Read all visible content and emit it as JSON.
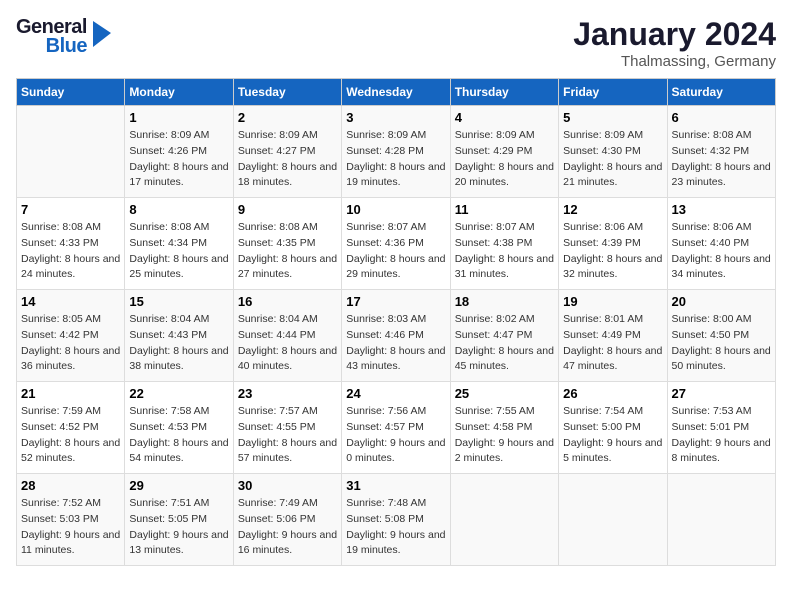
{
  "header": {
    "logo_line1": "General",
    "logo_line2": "Blue",
    "title": "January 2024",
    "subtitle": "Thalmassing, Germany"
  },
  "calendar": {
    "days_of_week": [
      "Sunday",
      "Monday",
      "Tuesday",
      "Wednesday",
      "Thursday",
      "Friday",
      "Saturday"
    ],
    "weeks": [
      [
        {
          "day": "",
          "sunrise": "",
          "sunset": "",
          "daylight": ""
        },
        {
          "day": "1",
          "sunrise": "Sunrise: 8:09 AM",
          "sunset": "Sunset: 4:26 PM",
          "daylight": "Daylight: 8 hours and 17 minutes."
        },
        {
          "day": "2",
          "sunrise": "Sunrise: 8:09 AM",
          "sunset": "Sunset: 4:27 PM",
          "daylight": "Daylight: 8 hours and 18 minutes."
        },
        {
          "day": "3",
          "sunrise": "Sunrise: 8:09 AM",
          "sunset": "Sunset: 4:28 PM",
          "daylight": "Daylight: 8 hours and 19 minutes."
        },
        {
          "day": "4",
          "sunrise": "Sunrise: 8:09 AM",
          "sunset": "Sunset: 4:29 PM",
          "daylight": "Daylight: 8 hours and 20 minutes."
        },
        {
          "day": "5",
          "sunrise": "Sunrise: 8:09 AM",
          "sunset": "Sunset: 4:30 PM",
          "daylight": "Daylight: 8 hours and 21 minutes."
        },
        {
          "day": "6",
          "sunrise": "Sunrise: 8:08 AM",
          "sunset": "Sunset: 4:32 PM",
          "daylight": "Daylight: 8 hours and 23 minutes."
        }
      ],
      [
        {
          "day": "7",
          "sunrise": "Sunrise: 8:08 AM",
          "sunset": "Sunset: 4:33 PM",
          "daylight": "Daylight: 8 hours and 24 minutes."
        },
        {
          "day": "8",
          "sunrise": "Sunrise: 8:08 AM",
          "sunset": "Sunset: 4:34 PM",
          "daylight": "Daylight: 8 hours and 25 minutes."
        },
        {
          "day": "9",
          "sunrise": "Sunrise: 8:08 AM",
          "sunset": "Sunset: 4:35 PM",
          "daylight": "Daylight: 8 hours and 27 minutes."
        },
        {
          "day": "10",
          "sunrise": "Sunrise: 8:07 AM",
          "sunset": "Sunset: 4:36 PM",
          "daylight": "Daylight: 8 hours and 29 minutes."
        },
        {
          "day": "11",
          "sunrise": "Sunrise: 8:07 AM",
          "sunset": "Sunset: 4:38 PM",
          "daylight": "Daylight: 8 hours and 31 minutes."
        },
        {
          "day": "12",
          "sunrise": "Sunrise: 8:06 AM",
          "sunset": "Sunset: 4:39 PM",
          "daylight": "Daylight: 8 hours and 32 minutes."
        },
        {
          "day": "13",
          "sunrise": "Sunrise: 8:06 AM",
          "sunset": "Sunset: 4:40 PM",
          "daylight": "Daylight: 8 hours and 34 minutes."
        }
      ],
      [
        {
          "day": "14",
          "sunrise": "Sunrise: 8:05 AM",
          "sunset": "Sunset: 4:42 PM",
          "daylight": "Daylight: 8 hours and 36 minutes."
        },
        {
          "day": "15",
          "sunrise": "Sunrise: 8:04 AM",
          "sunset": "Sunset: 4:43 PM",
          "daylight": "Daylight: 8 hours and 38 minutes."
        },
        {
          "day": "16",
          "sunrise": "Sunrise: 8:04 AM",
          "sunset": "Sunset: 4:44 PM",
          "daylight": "Daylight: 8 hours and 40 minutes."
        },
        {
          "day": "17",
          "sunrise": "Sunrise: 8:03 AM",
          "sunset": "Sunset: 4:46 PM",
          "daylight": "Daylight: 8 hours and 43 minutes."
        },
        {
          "day": "18",
          "sunrise": "Sunrise: 8:02 AM",
          "sunset": "Sunset: 4:47 PM",
          "daylight": "Daylight: 8 hours and 45 minutes."
        },
        {
          "day": "19",
          "sunrise": "Sunrise: 8:01 AM",
          "sunset": "Sunset: 4:49 PM",
          "daylight": "Daylight: 8 hours and 47 minutes."
        },
        {
          "day": "20",
          "sunrise": "Sunrise: 8:00 AM",
          "sunset": "Sunset: 4:50 PM",
          "daylight": "Daylight: 8 hours and 50 minutes."
        }
      ],
      [
        {
          "day": "21",
          "sunrise": "Sunrise: 7:59 AM",
          "sunset": "Sunset: 4:52 PM",
          "daylight": "Daylight: 8 hours and 52 minutes."
        },
        {
          "day": "22",
          "sunrise": "Sunrise: 7:58 AM",
          "sunset": "Sunset: 4:53 PM",
          "daylight": "Daylight: 8 hours and 54 minutes."
        },
        {
          "day": "23",
          "sunrise": "Sunrise: 7:57 AM",
          "sunset": "Sunset: 4:55 PM",
          "daylight": "Daylight: 8 hours and 57 minutes."
        },
        {
          "day": "24",
          "sunrise": "Sunrise: 7:56 AM",
          "sunset": "Sunset: 4:57 PM",
          "daylight": "Daylight: 9 hours and 0 minutes."
        },
        {
          "day": "25",
          "sunrise": "Sunrise: 7:55 AM",
          "sunset": "Sunset: 4:58 PM",
          "daylight": "Daylight: 9 hours and 2 minutes."
        },
        {
          "day": "26",
          "sunrise": "Sunrise: 7:54 AM",
          "sunset": "Sunset: 5:00 PM",
          "daylight": "Daylight: 9 hours and 5 minutes."
        },
        {
          "day": "27",
          "sunrise": "Sunrise: 7:53 AM",
          "sunset": "Sunset: 5:01 PM",
          "daylight": "Daylight: 9 hours and 8 minutes."
        }
      ],
      [
        {
          "day": "28",
          "sunrise": "Sunrise: 7:52 AM",
          "sunset": "Sunset: 5:03 PM",
          "daylight": "Daylight: 9 hours and 11 minutes."
        },
        {
          "day": "29",
          "sunrise": "Sunrise: 7:51 AM",
          "sunset": "Sunset: 5:05 PM",
          "daylight": "Daylight: 9 hours and 13 minutes."
        },
        {
          "day": "30",
          "sunrise": "Sunrise: 7:49 AM",
          "sunset": "Sunset: 5:06 PM",
          "daylight": "Daylight: 9 hours and 16 minutes."
        },
        {
          "day": "31",
          "sunrise": "Sunrise: 7:48 AM",
          "sunset": "Sunset: 5:08 PM",
          "daylight": "Daylight: 9 hours and 19 minutes."
        },
        {
          "day": "",
          "sunrise": "",
          "sunset": "",
          "daylight": ""
        },
        {
          "day": "",
          "sunrise": "",
          "sunset": "",
          "daylight": ""
        },
        {
          "day": "",
          "sunrise": "",
          "sunset": "",
          "daylight": ""
        }
      ]
    ]
  }
}
